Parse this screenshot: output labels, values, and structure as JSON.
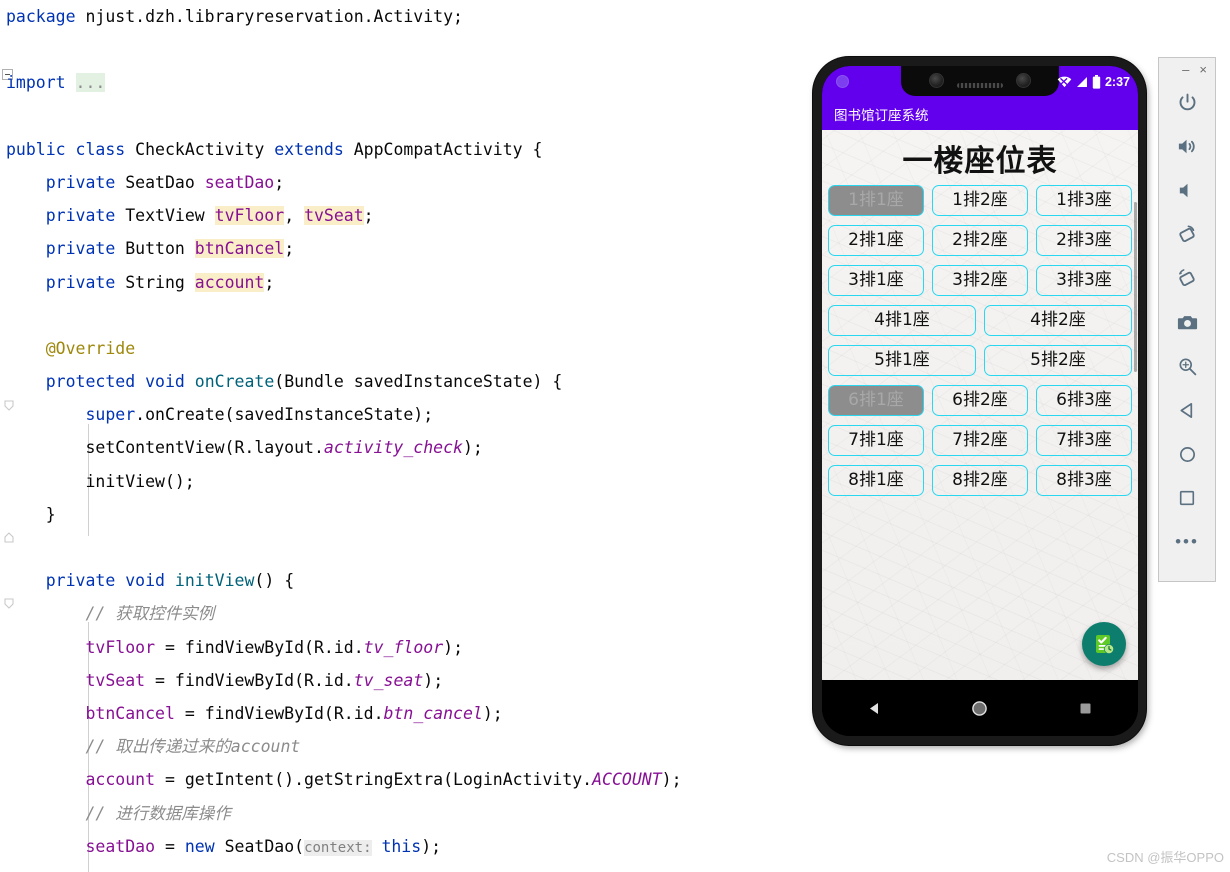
{
  "editor": {
    "language": "java",
    "lines": [
      {
        "id": "l1",
        "text": "package njust.dzh.libraryreservation.Activity;"
      },
      {
        "id": "l2",
        "text": ""
      },
      {
        "id": "l3",
        "text": "import ..."
      },
      {
        "id": "l4",
        "text": ""
      },
      {
        "id": "l5",
        "text": "public class CheckActivity extends AppCompatActivity {"
      },
      {
        "id": "l6",
        "text": "    private SeatDao seatDao;"
      },
      {
        "id": "l7",
        "text": "    private TextView tvFloor, tvSeat;"
      },
      {
        "id": "l8",
        "text": "    private Button btnCancel;"
      },
      {
        "id": "l9",
        "text": "    private String account;"
      },
      {
        "id": "l10",
        "text": ""
      },
      {
        "id": "l11",
        "text": "    @Override"
      },
      {
        "id": "l12",
        "text": "    protected void onCreate(Bundle savedInstanceState) {"
      },
      {
        "id": "l13",
        "text": "        super.onCreate(savedInstanceState);"
      },
      {
        "id": "l14",
        "text": "        setContentView(R.layout.activity_check);"
      },
      {
        "id": "l15",
        "text": "        initView();"
      },
      {
        "id": "l16",
        "text": "    }"
      },
      {
        "id": "l17",
        "text": ""
      },
      {
        "id": "l18",
        "text": "    private void initView() {"
      },
      {
        "id": "l19",
        "text": "        // 获取控件实例"
      },
      {
        "id": "l20",
        "text": "        tvFloor = findViewById(R.id.tv_floor);"
      },
      {
        "id": "l21",
        "text": "        tvSeat = findViewById(R.id.tv_seat);"
      },
      {
        "id": "l22",
        "text": "        btnCancel = findViewById(R.id.btn_cancel);"
      },
      {
        "id": "l23",
        "text": "        // 取出传递过来的account"
      },
      {
        "id": "l24",
        "text": "        account = getIntent().getStringExtra(LoginActivity.ACCOUNT);"
      },
      {
        "id": "l25",
        "text": "        // 进行数据库操作"
      },
      {
        "id": "l26",
        "text": "        seatDao = new SeatDao( context: this);"
      }
    ],
    "tokens": {
      "package": "package",
      "import": "import",
      "import_fold": "...",
      "public": "public",
      "class": "class",
      "class_name": "CheckActivity",
      "extends": "extends",
      "superclass": "AppCompatActivity",
      "private": "private",
      "protected": "protected",
      "void": "void",
      "new": "new",
      "super": "super",
      "this": "this",
      "override": "@Override",
      "param_hint": "context:"
    },
    "colors": {
      "keyword": "#0033b3",
      "field": "#871094",
      "field_highlight_bg": "#faeec8",
      "method": "#00627a",
      "comment": "#8c8c8c",
      "annotation": "#9e880d",
      "string": "#067d17",
      "background": "#ffffff",
      "text": "#080808"
    }
  },
  "emulator": {
    "window_buttons": {
      "minimize": "–",
      "close": "×"
    },
    "toolbar": [
      {
        "id": "power",
        "name": "power-icon",
        "label": "Power"
      },
      {
        "id": "volume-up",
        "name": "volume-up-icon",
        "label": "Volume Up"
      },
      {
        "id": "volume-down",
        "name": "volume-down-icon",
        "label": "Volume Down"
      },
      {
        "id": "rotate-left",
        "name": "rotate-left-icon",
        "label": "Rotate Left"
      },
      {
        "id": "rotate-right",
        "name": "rotate-right-icon",
        "label": "Rotate Right"
      },
      {
        "id": "screenshot",
        "name": "camera-icon",
        "label": "Take Screenshot"
      },
      {
        "id": "zoom",
        "name": "zoom-in-icon",
        "label": "Zoom Mode"
      },
      {
        "id": "back",
        "name": "back-triangle-icon",
        "label": "Back"
      },
      {
        "id": "home",
        "name": "home-circle-icon",
        "label": "Home"
      },
      {
        "id": "overview",
        "name": "overview-square-icon",
        "label": "Overview"
      },
      {
        "id": "more",
        "name": "more-dots-icon",
        "label": "More"
      }
    ],
    "status_bar": {
      "time": "2:37",
      "wifi": "wifi-off-icon",
      "signal": "signal-icon",
      "battery": "battery-full-icon"
    },
    "app": {
      "app_bar_title": "图书馆订座系统",
      "accent_color": "#6200EE",
      "page_title": "一楼座位表",
      "seat_border_color": "#2ad7f0",
      "seat_taken_color": "#8d8d8d",
      "fab": {
        "name": "check-schedule-fab",
        "background": "#0d7d6e",
        "icon_color": "#5ec927"
      },
      "seat_rows": [
        {
          "row": 1,
          "seats": [
            {
              "label": "1排1座",
              "taken": true
            },
            {
              "label": "1排2座",
              "taken": false
            },
            {
              "label": "1排3座",
              "taken": false
            }
          ]
        },
        {
          "row": 2,
          "seats": [
            {
              "label": "2排1座",
              "taken": false
            },
            {
              "label": "2排2座",
              "taken": false
            },
            {
              "label": "2排3座",
              "taken": false
            }
          ]
        },
        {
          "row": 3,
          "seats": [
            {
              "label": "3排1座",
              "taken": false
            },
            {
              "label": "3排2座",
              "taken": false
            },
            {
              "label": "3排3座",
              "taken": false
            }
          ]
        },
        {
          "row": 4,
          "seats": [
            {
              "label": "4排1座",
              "taken": false
            },
            {
              "label": "4排2座",
              "taken": false
            }
          ]
        },
        {
          "row": 5,
          "seats": [
            {
              "label": "5排1座",
              "taken": false
            },
            {
              "label": "5排2座",
              "taken": false
            }
          ]
        },
        {
          "row": 6,
          "seats": [
            {
              "label": "6排1座",
              "taken": true
            },
            {
              "label": "6排2座",
              "taken": false
            },
            {
              "label": "6排3座",
              "taken": false
            }
          ]
        },
        {
          "row": 7,
          "seats": [
            {
              "label": "7排1座",
              "taken": false
            },
            {
              "label": "7排2座",
              "taken": false
            },
            {
              "label": "7排3座",
              "taken": false
            }
          ]
        },
        {
          "row": 8,
          "seats": [
            {
              "label": "8排1座",
              "taken": false
            },
            {
              "label": "8排2座",
              "taken": false
            },
            {
              "label": "8排3座",
              "taken": false
            }
          ]
        }
      ]
    },
    "nav_bar": {
      "back": "back-triangle-icon",
      "home": "home-circle-icon",
      "recents": "recents-square-icon"
    }
  },
  "watermark": "CSDN @振华OPPO"
}
